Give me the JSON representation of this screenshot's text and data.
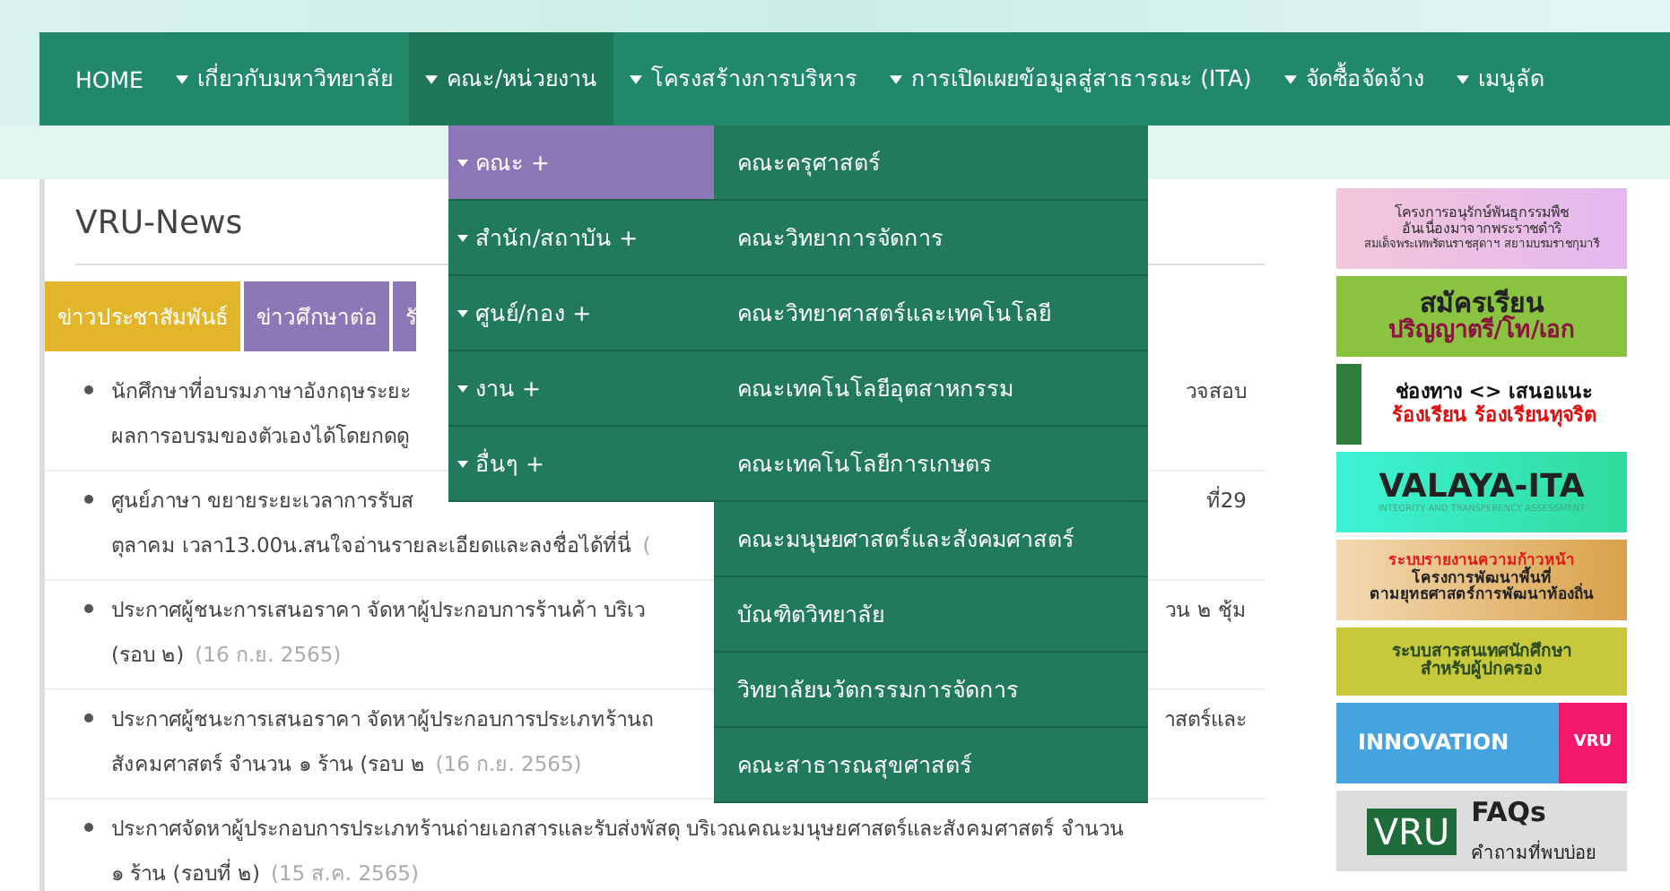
{
  "nav": {
    "items": [
      {
        "label": "HOME",
        "has_caret": false,
        "selected": false
      },
      {
        "label": "เกี่ยวกับมหาวิทยาลัย",
        "has_caret": true,
        "selected": false
      },
      {
        "label": "คณะ/หน่วยงาน",
        "has_caret": true,
        "selected": true
      },
      {
        "label": "โครงสร้างการบริหาร",
        "has_caret": true,
        "selected": false
      },
      {
        "label": "การเปิดเผยข้อมูลสู่สาธารณะ (ITA)",
        "has_caret": true,
        "selected": false
      },
      {
        "label": "จัดซื้อจัดจ้าง",
        "has_caret": true,
        "selected": false
      },
      {
        "label": "เมนูลัด",
        "has_caret": true,
        "selected": false
      }
    ]
  },
  "dropdown": {
    "groups": [
      {
        "label": "คณะ +",
        "selected": true
      },
      {
        "label": "สำนัก/สถาบัน +",
        "selected": false
      },
      {
        "label": "ศูนย์/กอง +",
        "selected": false
      },
      {
        "label": "งาน +",
        "selected": false
      },
      {
        "label": "อื่นๆ +",
        "selected": false
      }
    ],
    "submenu": [
      "คณะครุศาสตร์",
      "คณะวิทยาการจัดการ",
      "คณะวิทยาศาสตร์และเทคโนโลยี",
      "คณะเทคโนโลยีอุตสาหกรรม",
      "คณะเทคโนโลยีการเกษตร",
      "คณะมนุษยศาสตร์และสังคมศาสตร์",
      "บัณฑิตวิทยาลัย",
      "วิทยาลัยนวัตกรรมการจัดการ",
      "คณะสาธารณสุขศาสตร์"
    ]
  },
  "news": {
    "title": "VRU-News",
    "tabs": [
      {
        "label": "ข่าวประชาสัมพันธ์",
        "selected": true
      },
      {
        "label": "ข่าวศึกษาต่อ",
        "selected": false
      },
      {
        "label": "รั",
        "selected": false
      }
    ],
    "items": [
      {
        "lines": [
          {
            "text": "นักศึกษาที่อบรมภาษาอังกฤษระยะ",
            "tail": "วจสอบ"
          },
          {
            "text": "ผลการอบรมของตัวเองได้โดยกดดู"
          }
        ]
      },
      {
        "lines": [
          {
            "text": "ศูนย์ภาษา ขยายระยะเวลาการรับส",
            "tail": "ที่29"
          },
          {
            "text": "ตุลาคม เวลา13.00น.สนใจอ่านรายละเอียดและลงชื่อได้ที่นี่",
            "date": "("
          }
        ]
      },
      {
        "lines": [
          {
            "text": "ประกาศผู้ชนะการเสนอราคา จัดหาผู้ประกอบการร้านค้า บริเว",
            "tail": "วน ๒ ชุ้ม"
          },
          {
            "text": "(รอบ ๒)",
            "date": "(16 ก.ย. 2565)"
          }
        ]
      },
      {
        "lines": [
          {
            "text": "ประกาศผู้ชนะการเสนอราคา จัดหาผู้ประกอบการประเภทร้านถ",
            "tail": "าสตร์และ"
          },
          {
            "text": "สังคมศาสตร์ จำนวน ๑ ร้าน (รอบ ๒",
            "date": "(16 ก.ย. 2565)"
          }
        ]
      },
      {
        "lines": [
          {
            "text": "ประกาศจัดหาผู้ประกอบการประเภทร้านถ่ายเอกสารและรับส่งพัสดุ บริเวณคณะมนุษยศาสตร์และสังคมศาสตร์ จำนวน"
          },
          {
            "text": "๑ ร้าน (รอบที่ ๒)",
            "date": "(15 ส.ค. 2565)"
          }
        ]
      }
    ]
  },
  "banners": [
    {
      "kind": "flower",
      "lines": [
        "โครงการอนุรักษ์พันธุกรรมพืช",
        "อันเนื่องมาจากพระราชดำริ",
        "สมเด็จพระเทพรัตนราชสุดาฯ สยามบรมราชกุมารี"
      ]
    },
    {
      "kind": "enroll",
      "lines": [
        "สมัครเรียน",
        "ปริญญาตรี/โท/เอก"
      ]
    },
    {
      "kind": "complaint",
      "lines": [
        "ช่องทาง <> เสนอแนะ",
        "ร้องเรียน ร้องเรียนทุจริต"
      ]
    },
    {
      "kind": "ita",
      "lines": [
        "VALAYA-ITA",
        "INTEGRITY AND TRANSPERENCY ASSESSMENT"
      ]
    },
    {
      "kind": "report",
      "lines": [
        "ระบบรายงานความก้าวหน้า",
        "โครงการพัฒนาพื้นที่",
        "ตามยุทธศาสตร์การพัฒนาท้องถิ่น"
      ]
    },
    {
      "kind": "parents",
      "lines": [
        "ระบบสารสนเทศนักศึกษา",
        "สำหรับผู้ปกครอง"
      ]
    },
    {
      "kind": "innovation",
      "lines": [
        "INNOVATION",
        "VRU"
      ]
    },
    {
      "kind": "faq",
      "lines": [
        "VRU",
        "FAQs",
        "คำถามที่พบบ่อย"
      ]
    }
  ]
}
